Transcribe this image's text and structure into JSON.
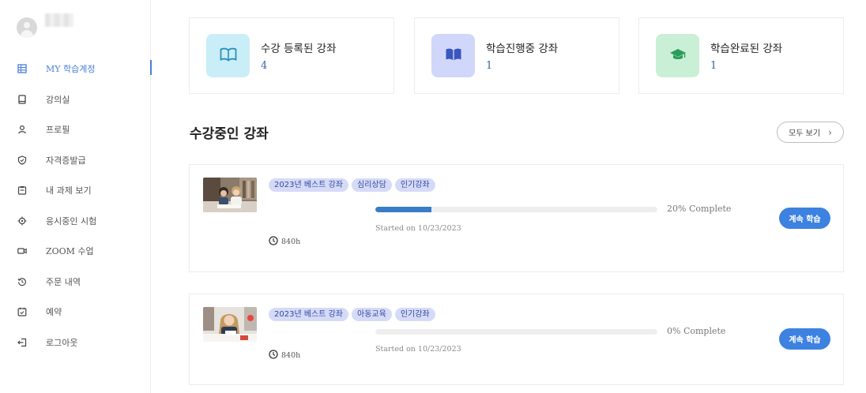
{
  "sidebar": {
    "items": [
      {
        "label": "MY 학습계정",
        "icon": "grid-icon",
        "active": true
      },
      {
        "label": "강의실",
        "icon": "book-icon"
      },
      {
        "label": "프로필",
        "icon": "person-icon"
      },
      {
        "label": "자격증발급",
        "icon": "shield-check-icon"
      },
      {
        "label": "내 과제 보기",
        "icon": "clipboard-icon"
      },
      {
        "label": "응시중인 시험",
        "icon": "target-icon"
      },
      {
        "label": "ZOOM 수업",
        "icon": "video-icon"
      },
      {
        "label": "주문 내역",
        "icon": "history-icon"
      },
      {
        "label": "예약",
        "icon": "calendar-check-icon"
      },
      {
        "label": "로그아웃",
        "icon": "logout-icon"
      }
    ]
  },
  "stats": [
    {
      "label": "수강 등록된 강좌",
      "count": "4",
      "icon": "open-book-icon",
      "bg": "#c9eef7",
      "fg": "#2b8fb5"
    },
    {
      "label": "학습진행중 강좌",
      "count": "1",
      "icon": "reading-book-icon",
      "bg": "#d0d7fa",
      "fg": "#3a56c0"
    },
    {
      "label": "학습완료된 강좌",
      "count": "1",
      "icon": "graduation-cap-icon",
      "bg": "#c9f0d6",
      "fg": "#2d9c5a"
    }
  ],
  "section": {
    "title": "수강중인 강좌",
    "view_all": "모두 보기"
  },
  "courses": [
    {
      "tags": [
        "2023년 베스트 강좌",
        "심리상담",
        "인기강좌"
      ],
      "progress": 20,
      "progress_text": "20% Complete",
      "started": "Started on 10/23/2023",
      "hours": "840h",
      "button": "계속 학습"
    },
    {
      "tags": [
        "2023년 베스트 강좌",
        "아동교육",
        "인기강좌"
      ],
      "progress": 0,
      "progress_text": "0% Complete",
      "started": "Started on 10/23/2023",
      "hours": "840h",
      "button": "계속 학습"
    }
  ],
  "colors": {
    "accent": "#4a7fd8",
    "button": "#3d82e0",
    "progress": "#3a7cc6",
    "tag_bg": "#d5dbf7"
  }
}
